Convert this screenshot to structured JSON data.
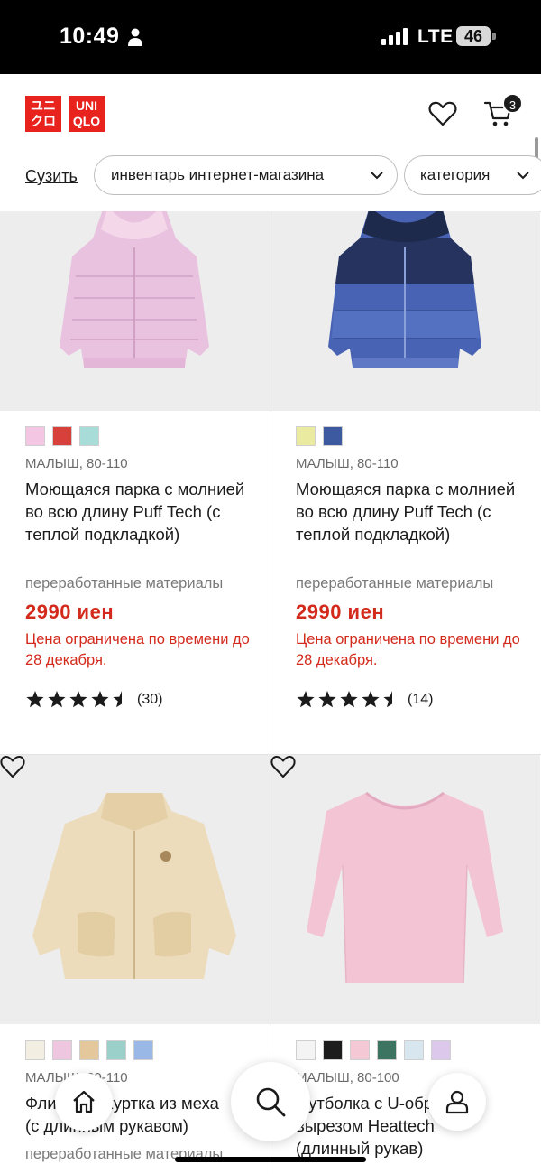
{
  "status_bar": {
    "time": "10:49",
    "network": "LTE",
    "battery": "46"
  },
  "header": {
    "logo_line1": "ユニ",
    "logo_line2": "クロ",
    "logo_line3": "UNI",
    "logo_line4": "QLO",
    "cart_count": "3"
  },
  "filters": {
    "narrow_label": "Сузить",
    "chip1": "инвентарь интернет-магазина",
    "chip2": "категория"
  },
  "products": [
    {
      "swatches": [
        "#f3c6e4",
        "#d8413b",
        "#a8dcd8"
      ],
      "meta": "МАЛЫШ, 80-110",
      "name": "Моющаяся парка с молнией во всю длину Puff Tech (с теплой подкладкой)",
      "material": "переработанные материалы",
      "price": "2990 иен",
      "promo": "Цена ограничена по времени до 28 декабря.",
      "rating_value": 4.5,
      "reviews": "(30)"
    },
    {
      "swatches": [
        "#eaeaa0",
        "#3d5aa0"
      ],
      "meta": "МАЛЫШ, 80-110",
      "name": "Моющаяся парка с молнией во всю длину Puff Tech (с теплой подкладкой)",
      "material": "переработанные материалы",
      "price": "2990 иен",
      "promo": "Цена ограничена по времени до 28 декабря.",
      "rating_value": 4.5,
      "reviews": "(14)"
    },
    {
      "swatches": [
        "#f2efe2",
        "#efc6df",
        "#e4c79a",
        "#9bcfc9",
        "#9ab8e6"
      ],
      "meta": "МАЛЫШ, 80-110",
      "name_line1": "Флисовая куртка из меха",
      "name_line2": "(с длинным рукавом)",
      "material": "переработанные материалы"
    },
    {
      "swatches": [
        "#f4f4f4",
        "#1c1c1c",
        "#f4c8d4",
        "#3d7461",
        "#d8e6ef",
        "#dcc8ea"
      ],
      "meta": "МАЛЫШ, 80-100",
      "name_line1": "Футболка с U-образным",
      "name_line2": "вырезом Heattech",
      "name_line3": "(длинный рукав)"
    }
  ]
}
